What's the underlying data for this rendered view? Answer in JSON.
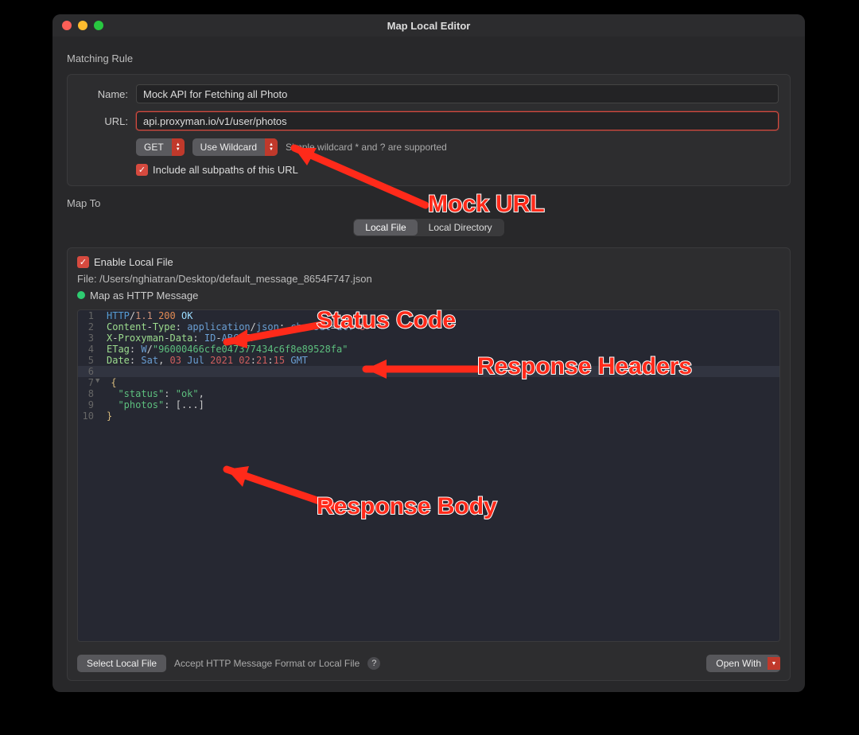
{
  "window": {
    "title": "Map Local Editor"
  },
  "matching": {
    "section_title": "Matching Rule",
    "name_label": "Name:",
    "name_value": "Mock API for Fetching all Photo",
    "url_label": "URL:",
    "url_value": "api.proxyman.io/v1/user/photos",
    "method_dropdown": "GET",
    "wildcard_dropdown": "Use Wildcard",
    "wildcard_hint": "Simple wildcard * and ? are supported",
    "include_subpaths": "Include all subpaths of this URL"
  },
  "mapto": {
    "section_title": "Map To",
    "tabs": {
      "local_file": "Local File",
      "local_directory": "Local Directory"
    },
    "enable_local_file": "Enable Local File",
    "file_prefix": "File: ",
    "file_path": "/Users/nghiatran/Desktop/default_message_8654F747.json",
    "map_as": "Map as HTTP Message"
  },
  "editor_lines": [
    {
      "n": 1,
      "html": "<span class='tk-kw'>HTTP</span><span class='tk-punc'>/</span><span class='tk-ver'>1.1</span> <span class='tk-num'>200</span> <span class='tk-ok'>OK</span>"
    },
    {
      "n": 2,
      "html": "<span class='tk-hdr'>Content</span><span class='tk-punc'>-</span><span class='tk-hdr'>Type</span><span class='tk-punc'>:</span> <span class='tk-val'>application</span><span class='tk-punc'>/</span><span class='tk-val'>json</span><span class='tk-punc'>;</span> <span class='tk-val'>charset</span><span class='tk-punc'>=</span><span class='tk-val'>utf</span><span class='tk-punc'>-</span><span class='tk-red'>8</span>"
    },
    {
      "n": 3,
      "html": "<span class='tk-hdr'>X</span><span class='tk-punc'>-</span><span class='tk-hdr'>Proxyman</span><span class='tk-punc'>-</span><span class='tk-hdr'>Data</span><span class='tk-punc'>:</span> <span class='tk-val'>ID</span><span class='tk-punc'>-</span><span class='tk-val'>ABCDEF</span>"
    },
    {
      "n": 4,
      "html": "<span class='tk-hdr'>ETag</span><span class='tk-punc'>:</span> <span class='tk-val'>W</span><span class='tk-punc'>/</span><span class='tk-str'>\"96000466cfe047377434c6f8e89528fa\"</span>"
    },
    {
      "n": 5,
      "html": "<span class='tk-hdr'>Date</span><span class='tk-punc'>:</span> <span class='tk-val'>Sat</span><span class='tk-punc'>,</span> <span class='tk-red'>03</span> <span class='tk-val'>Jul</span> <span class='tk-red'>2021</span> <span class='tk-red'>02</span><span class='tk-punc'>:</span><span class='tk-red'>21</span><span class='tk-punc'>:</span><span class='tk-red'>15</span> <span class='tk-val'>GMT</span>"
    },
    {
      "n": 6,
      "html": "",
      "hl": true
    },
    {
      "n": 7,
      "html": "<span class='tk-gold'>{</span>",
      "fold": true
    },
    {
      "n": 8,
      "html": "  <span class='tk-str'>\"status\"</span><span class='tk-punc'>:</span> <span class='tk-str'>\"ok\"</span><span class='tk-punc'>,</span>"
    },
    {
      "n": 9,
      "html": "  <span class='tk-str'>\"photos\"</span><span class='tk-punc'>:</span> <span class='tk-punc'>[...]</span>"
    },
    {
      "n": 10,
      "html": "<span class='tk-gold'>}</span>"
    }
  ],
  "footer": {
    "select_file": "Select Local File",
    "accept_hint": "Accept HTTP Message Format or Local File",
    "open_with": "Open With"
  },
  "annotations": {
    "mock_url": "Mock URL",
    "status_code": "Status Code",
    "response_headers": "Response Headers",
    "response_body": "Response Body"
  }
}
